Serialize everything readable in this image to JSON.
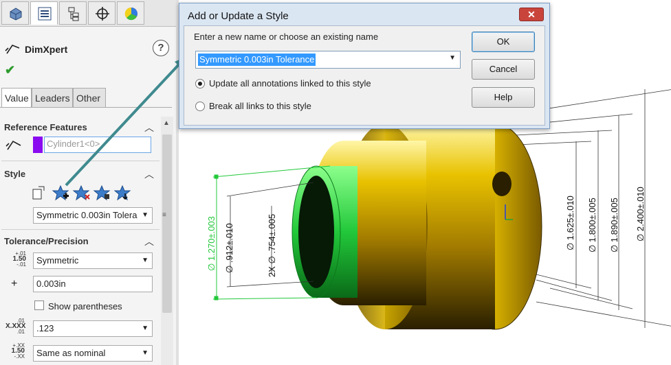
{
  "pm_tabs": [
    {
      "icon": "feature-tree-icon"
    },
    {
      "icon": "property-manager-icon"
    },
    {
      "icon": "configuration-manager-icon"
    },
    {
      "icon": "dimxpert-manager-icon"
    },
    {
      "icon": "display-manager-icon"
    }
  ],
  "property_manager": {
    "title": "DimXpert",
    "help_label": "?",
    "tabs": [
      "Value",
      "Leaders",
      "Other"
    ],
    "reference_features": {
      "heading": "Reference Features",
      "field_value": "Cylinder1<0>",
      "color": "#8a0bf0"
    },
    "style": {
      "heading": "Style",
      "selected": "Symmetric 0.003in Tolera"
    },
    "tolerance": {
      "heading": "Tolerance/Precision",
      "type": "Symmetric",
      "value": "0.003in",
      "plus_label": "+",
      "show_parentheses": "Show parentheses",
      "primary_precision": ".123",
      "tolerance_precision": "Same as nominal",
      "icon1": {
        "top": "+.01",
        "mid": "1.50",
        "bot": "-.01"
      },
      "icon2": {
        "top": ".01",
        "mid": "X.XXX",
        "bot": ".01"
      },
      "icon3": {
        "top": "+.XX",
        "mid": "1.50",
        "bot": "-.XX"
      }
    }
  },
  "dialog": {
    "title": "Add or Update a Style",
    "close_label": "✕",
    "prompt": "Enter a new name or choose an existing name",
    "combo_value": "Symmetric 0.003in Tolerance",
    "radio_update": "Update all annotations linked to this style",
    "radio_break": "Break all links to this style",
    "ok_label": "OK",
    "cancel_label": "Cancel",
    "help_label": "Help"
  },
  "dimensions": {
    "d1": "∅ 1.270±.003",
    "d2": "∅ .912±.010",
    "d3": "2X ∅ .754±.005",
    "d4": "∅ 1.625±.010",
    "d5": "∅ 1.800±.005",
    "d6": "∅ 1.890±.005",
    "d7": "∅ 2.400±.010"
  },
  "colors": {
    "part_gold": "#d9b400",
    "selection_green": "#22d84a",
    "arrow_teal": "#3f8a8f"
  }
}
